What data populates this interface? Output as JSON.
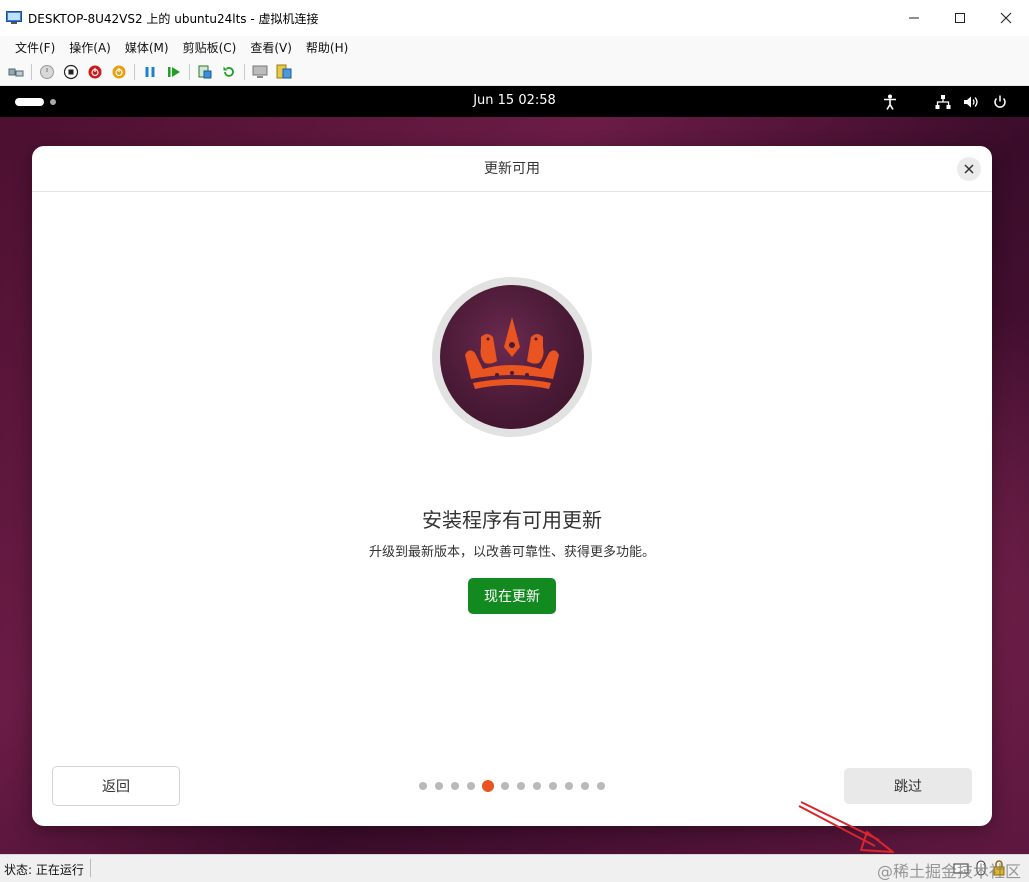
{
  "window": {
    "title": "DESKTOP-8U42VS2 上的 ubuntu24lts - 虚拟机连接"
  },
  "menu": [
    "文件(F)",
    "操作(A)",
    "媒体(M)",
    "剪贴板(C)",
    "查看(V)",
    "帮助(H)"
  ],
  "toolbar_icons": [
    "ctrl-alt-del-icon",
    "start-icon",
    "turn-off-icon",
    "shutdown-icon",
    "save-icon",
    "pause-icon",
    "reset-icon",
    "checkpoint-icon",
    "revert-icon",
    "enhanced-session-icon",
    "share-icon"
  ],
  "vm_topbar": {
    "clock": "Jun 15  02:58"
  },
  "dialog": {
    "title": "更新可用",
    "headline": "安装程序有可用更新",
    "subline": "升级到最新版本，以改善可靠性、获得更多功能。",
    "update_button": "现在更新",
    "back_button": "返回",
    "skip_button": "跳过",
    "page_dots_total": 12,
    "page_dots_active": 5
  },
  "colors": {
    "accent_orange": "#e95420",
    "update_green": "#138a1f",
    "annotation_red": "#d9262c"
  },
  "statusbar": {
    "status": "状态: 正在运行",
    "watermark": "@稀土掘金技术社区"
  }
}
